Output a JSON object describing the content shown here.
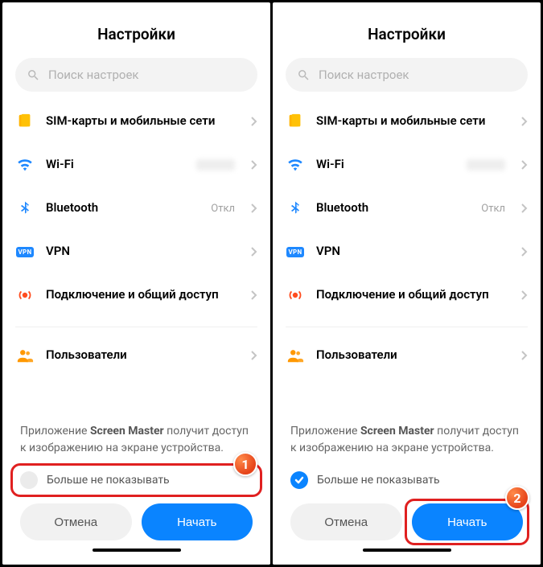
{
  "left": {
    "title": "Настройки",
    "search_placeholder": "Поиск настроек",
    "items": {
      "sim": "SIM-карты и мобильные сети",
      "wifi": "Wi-Fi",
      "bt": "Bluetooth",
      "bt_val": "Откл",
      "vpn": "VPN",
      "tether": "Подключение и общий доступ",
      "users": "Пользователи"
    },
    "dialog": {
      "pre": "Приложение ",
      "app": "Screen Master",
      "post": " получит доступ к изображению на экране устройства.",
      "dont_show": "Больше не показывать",
      "cancel": "Отмена",
      "start": "Начать"
    },
    "badge": "1"
  },
  "right": {
    "title": "Настройки",
    "search_placeholder": "Поиск настроек",
    "items": {
      "sim": "SIM-карты и мобильные сети",
      "wifi": "Wi-Fi",
      "bt": "Bluetooth",
      "bt_val": "Откл",
      "vpn": "VPN",
      "tether": "Подключение и общий доступ",
      "users": "Пользователи"
    },
    "dialog": {
      "pre": "Приложение ",
      "app": "Screen Master",
      "post": " получит доступ к изображению на экране устройства.",
      "dont_show": "Больше не показывать",
      "cancel": "Отмена",
      "start": "Начать"
    },
    "badge": "2"
  }
}
